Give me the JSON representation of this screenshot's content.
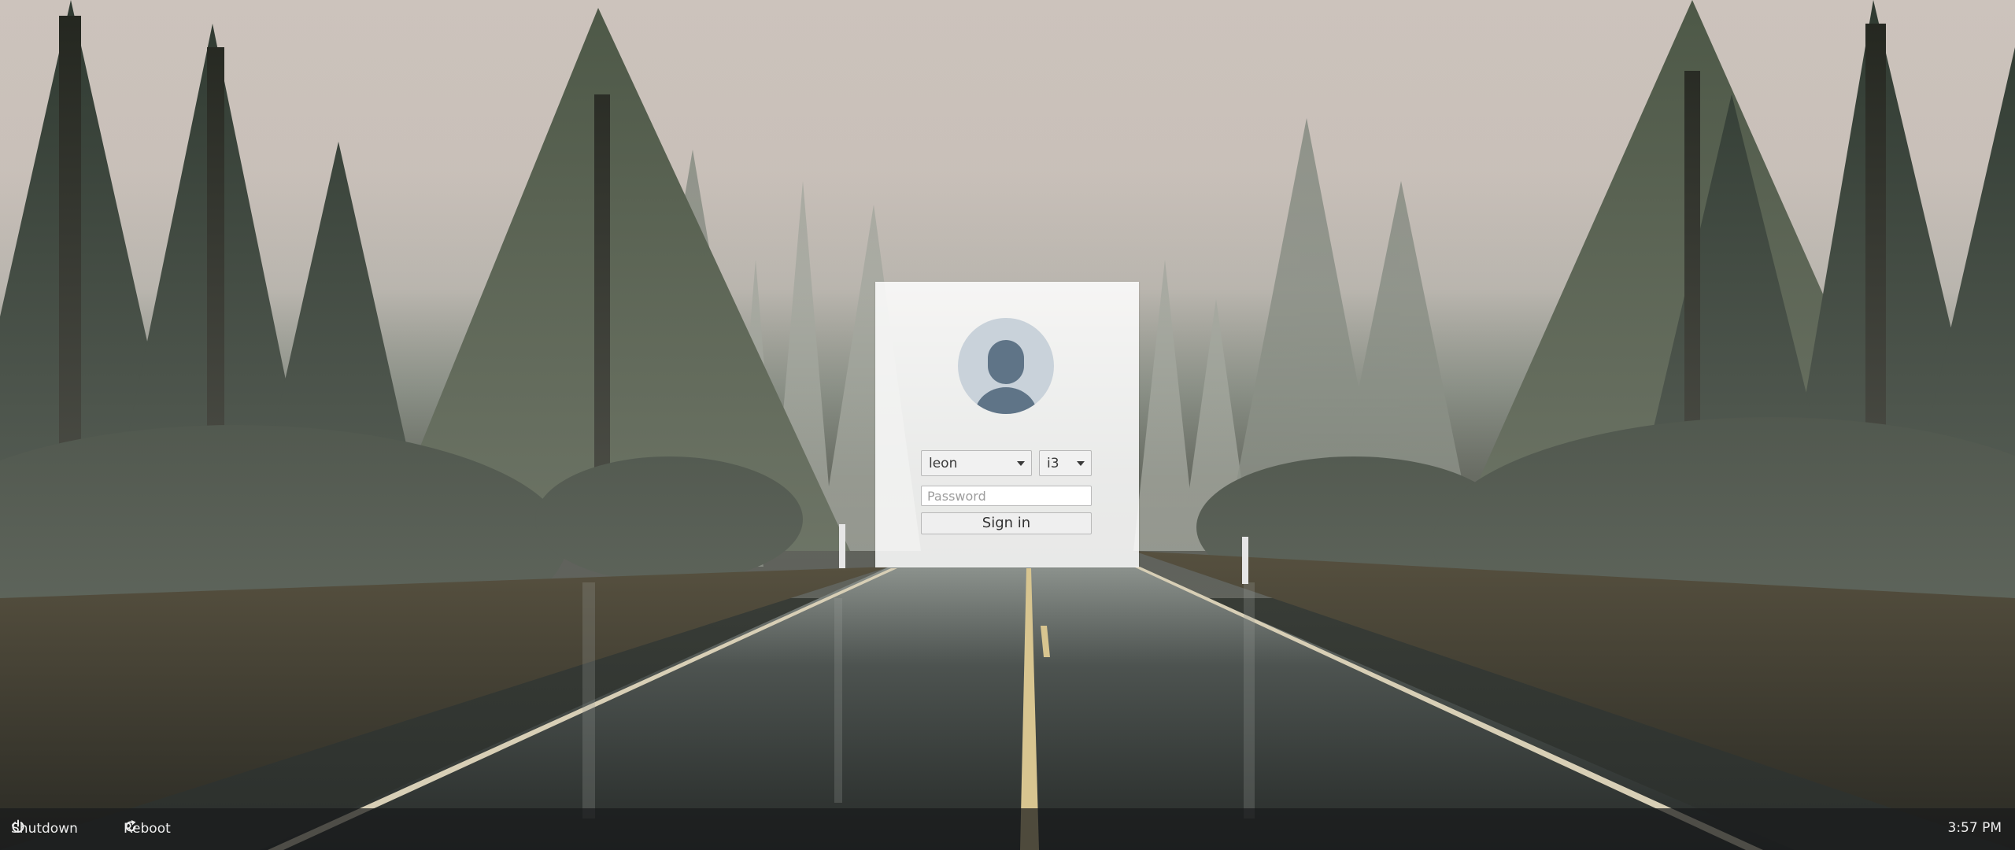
{
  "login": {
    "username": "leon",
    "session": "i3",
    "password_placeholder": "Password",
    "signin_label": "Sign in"
  },
  "bottombar": {
    "shutdown_label": "Shutdown",
    "reboot_label": "Reboot",
    "clock": "3:57 PM"
  },
  "icons": {
    "avatar": "user-silhouette-icon",
    "shutdown": "power-icon",
    "reboot": "refresh-icon"
  },
  "colors": {
    "card": "#f4f4f4",
    "bar": "#1f2122",
    "road_line": "#d8c590"
  }
}
